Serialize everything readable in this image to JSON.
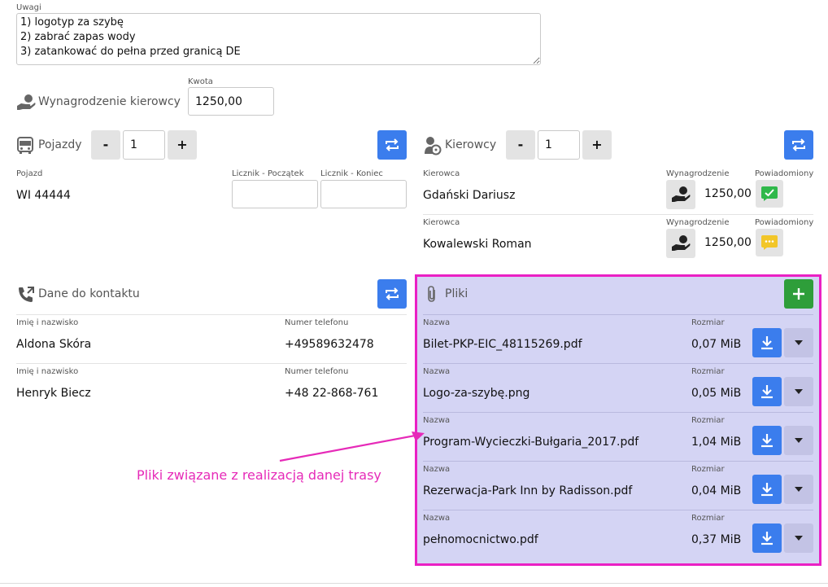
{
  "notes": {
    "label": "Uwagi",
    "value": "1) logotyp za szybę\n2) zabrać zapas wody\n3) zatankować do pełna przed granicą DE"
  },
  "driver_pay": {
    "label": "Wynagrodzenie kierowcy",
    "amount_label": "Kwota",
    "amount": "1250,00",
    "icon": "hand-money-icon"
  },
  "vehicles": {
    "title": "Pojazdy",
    "icon": "bus-icon",
    "minus": "-",
    "plus": "+",
    "count": "1",
    "col_vehicle": "Pojazd",
    "col_start": "Licznik - Początek",
    "col_end": "Licznik - Koniec",
    "rows": [
      {
        "plate": "WI 44444",
        "start": "",
        "end": ""
      }
    ]
  },
  "drivers": {
    "title": "Kierowcy",
    "icon": "driver-icon",
    "minus": "-",
    "plus": "+",
    "count": "1",
    "col_driver": "Kierowca",
    "col_pay": "Wynagrodzenie",
    "col_notified": "Powiadomiony",
    "rows": [
      {
        "name": "Gdański Dariusz",
        "pay": "1250,00",
        "notified_icon": "check-icon",
        "notified_color": "#2fb84a"
      },
      {
        "name": "Kowalewski Roman",
        "pay": "1250,00",
        "notified_icon": "message-icon",
        "notified_color": "#f2c628"
      }
    ]
  },
  "contacts": {
    "title": "Dane do kontaktu",
    "icon": "phone-icon",
    "col_name": "Imię i nazwisko",
    "col_phone": "Numer telefonu",
    "rows": [
      {
        "name": "Aldona Skóra",
        "phone": "+49589632478"
      },
      {
        "name": "Henryk Biecz",
        "phone": "+48 22-868-761"
      }
    ]
  },
  "files": {
    "title": "Pliki",
    "icon": "paperclip-icon",
    "col_name": "Nazwa",
    "col_size": "Rozmiar",
    "rows": [
      {
        "name": "Bilet-PKP-EIC_48115269.pdf",
        "size": "0,07 MiB"
      },
      {
        "name": "Logo-za-szybę.png",
        "size": "0,05 MiB"
      },
      {
        "name": "Program-Wycieczki-Bułgaria_2017.pdf",
        "size": "1,04 MiB"
      },
      {
        "name": "Rezerwacja-Park Inn by Radisson.pdf",
        "size": "0,04 MiB"
      },
      {
        "name": "pełnomocnictwo.pdf",
        "size": "0,37 MiB"
      }
    ]
  },
  "annotation": {
    "text": "Pliki związane z realizacją danej trasy",
    "color": "#e62ab8"
  },
  "colors": {
    "primary": "#3b7ded",
    "success": "#2e9e3a",
    "highlight_border": "#ea20c4",
    "highlight_fill": "#d4d4f4"
  }
}
